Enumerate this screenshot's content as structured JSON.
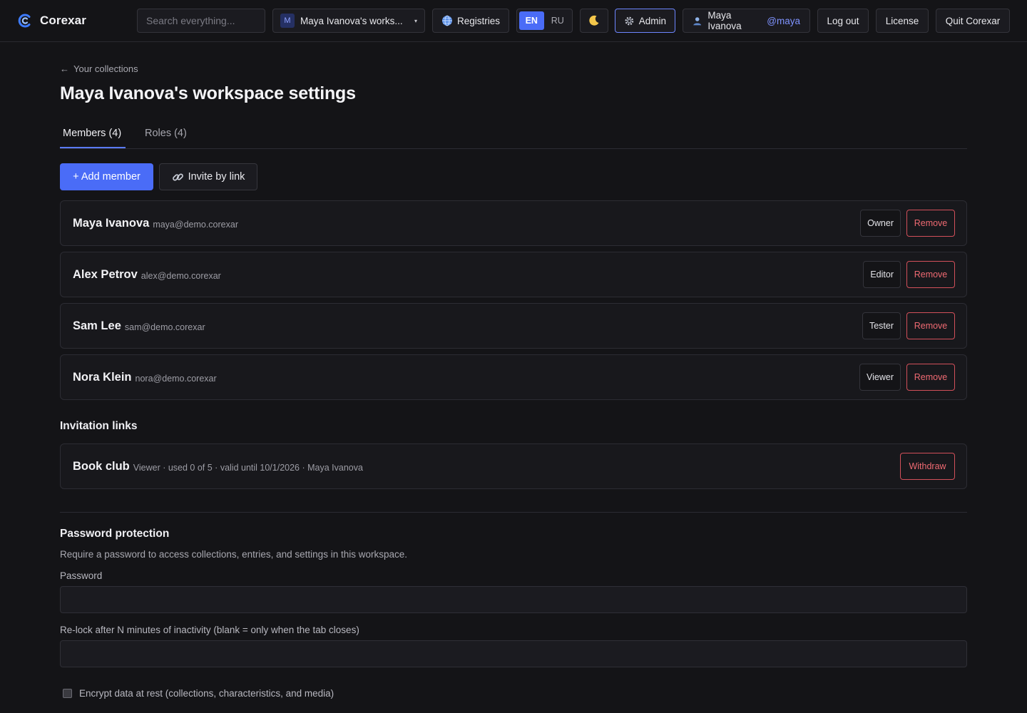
{
  "app": {
    "name": "Corexar",
    "accent": "#4a6cf7",
    "danger": "#ef6a72"
  },
  "topbar": {
    "search_placeholder": "Search everything...",
    "workspace": {
      "initial": "M",
      "name": "Maya Ivanova's works...",
      "caret": "▾"
    },
    "registries_label": "Registries",
    "languages": [
      {
        "code": "EN",
        "active": true
      },
      {
        "code": "RU",
        "active": false
      }
    ],
    "theme_icon": "moon-icon",
    "admin_label": "Admin",
    "user": {
      "name": "Maya Ivanova",
      "handle": "@maya"
    },
    "logout_label": "Log out",
    "license_label": "License",
    "quit_label": "Quit Corexar"
  },
  "page": {
    "back_label": "Your collections",
    "title": "Maya Ivanova's workspace settings",
    "tabs": [
      {
        "label": "Members (4)",
        "active": true
      },
      {
        "label": "Roles (4)",
        "active": false
      }
    ],
    "add_member_label": "+ Add member",
    "invite_label": "Invite by link"
  },
  "members": [
    {
      "name": "Maya Ivanova",
      "email": "maya@demo.corexar",
      "role": "Owner",
      "remove_label": "Remove"
    },
    {
      "name": "Alex Petrov",
      "email": "alex@demo.corexar",
      "role": "Editor",
      "remove_label": "Remove"
    },
    {
      "name": "Sam Lee",
      "email": "sam@demo.corexar",
      "role": "Tester",
      "remove_label": "Remove"
    },
    {
      "name": "Nora Klein",
      "email": "nora@demo.corexar",
      "role": "Viewer",
      "remove_label": "Remove"
    }
  ],
  "invitations": {
    "heading": "Invitation links",
    "items": [
      {
        "name": "Book club",
        "details": "Viewer · used 0 of 5 · valid until 10/1/2026 · Maya Ivanova",
        "withdraw_label": "Withdraw"
      }
    ]
  },
  "password_protection": {
    "heading": "Password protection",
    "description": "Require a password to access collections, entries, and settings in this workspace.",
    "password_label": "Password",
    "password_value": "",
    "relock_label": "Re-lock after N minutes of inactivity (blank = only when the tab closes)",
    "relock_value": "",
    "encrypt_label": "Encrypt data at rest (collections, characteristics, and media)",
    "encrypt_checked": false
  }
}
